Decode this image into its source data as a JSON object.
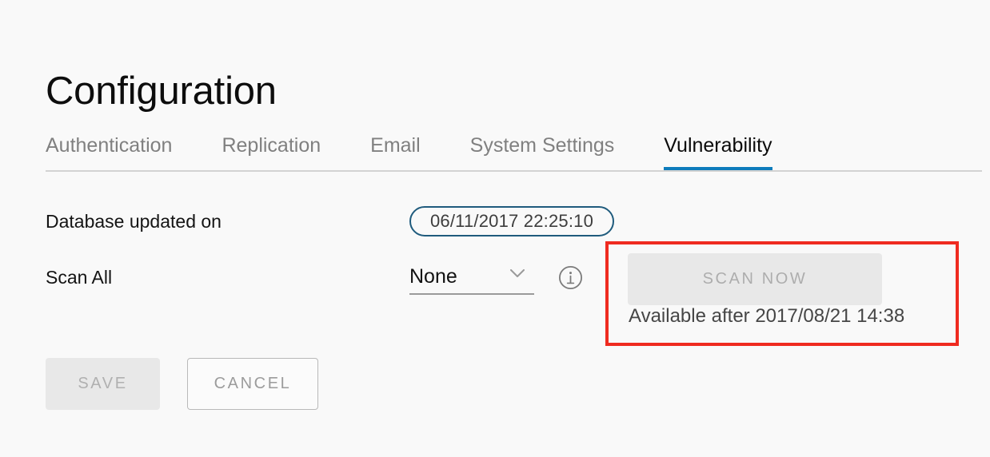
{
  "page": {
    "title": "Configuration",
    "background_color": "#f9f9f9",
    "accent_color": "#0d7cbc",
    "highlight_color": "#ef2b20"
  },
  "tabs": [
    {
      "label": "Authentication",
      "active": false
    },
    {
      "label": "Replication",
      "active": false
    },
    {
      "label": "Email",
      "active": false
    },
    {
      "label": "System Settings",
      "active": false
    },
    {
      "label": "Vulnerability",
      "active": true
    }
  ],
  "form": {
    "database_updated": {
      "label": "Database updated on",
      "value": "06/11/2017 22:25:10"
    },
    "scan_all": {
      "label": "Scan All",
      "selected_option": "None",
      "options": [
        "None"
      ],
      "chevron_icon": "chevron-down-icon",
      "info_icon": "info-circle-icon"
    }
  },
  "scan_panel": {
    "scan_now_label": "SCAN NOW",
    "scan_now_disabled": true,
    "availability_text": "Available after 2017/08/21 14:38"
  },
  "actions": {
    "save_label": "SAVE",
    "save_disabled": true,
    "cancel_label": "CANCEL"
  }
}
